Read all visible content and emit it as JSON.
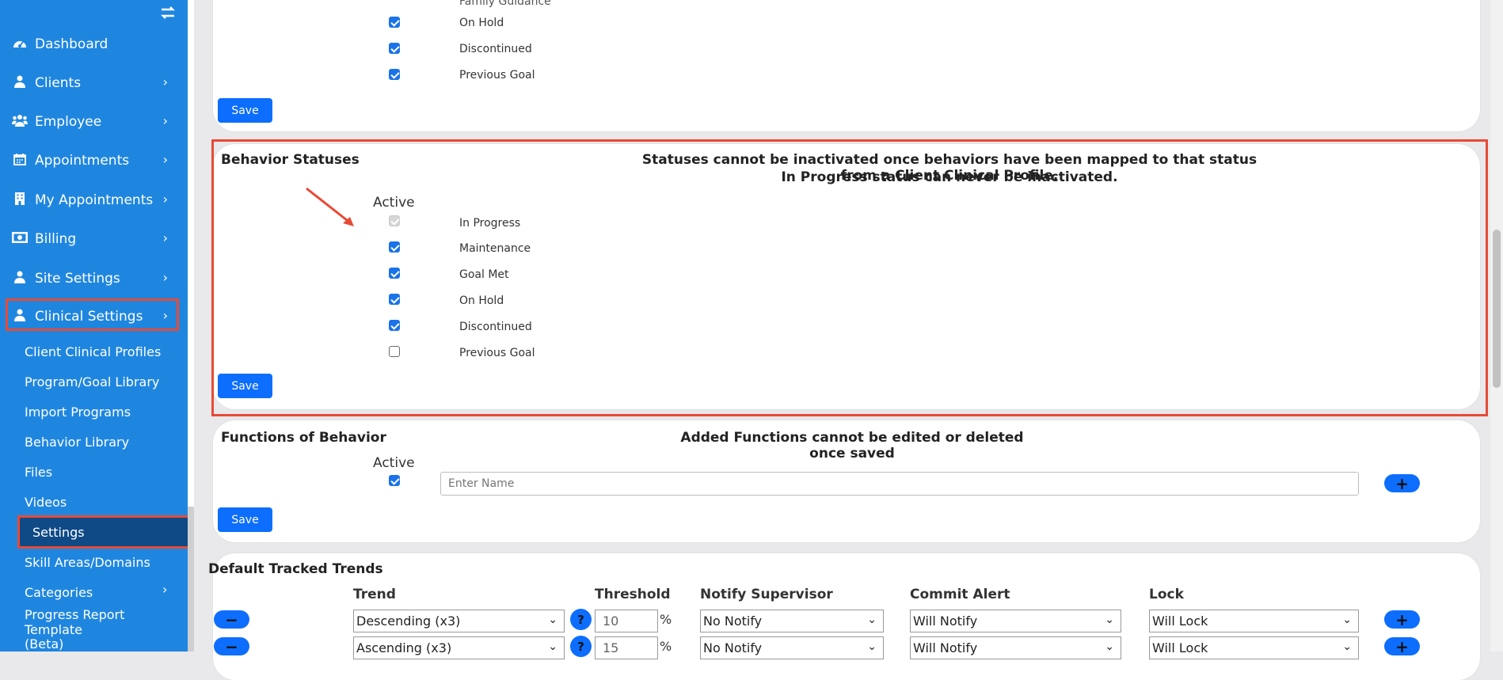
{
  "sidebar": {
    "toggle_icon": "swap-arrows-icon",
    "items": [
      {
        "label": "Dashboard",
        "icon": "dashboard-icon",
        "has_chevron": false
      },
      {
        "label": "Clients",
        "icon": "user-icon",
        "has_chevron": true
      },
      {
        "label": "Employee",
        "icon": "users-icon",
        "has_chevron": true
      },
      {
        "label": "Appointments",
        "icon": "calendar-icon",
        "has_chevron": true
      },
      {
        "label": "My Appointments",
        "icon": "building-icon",
        "has_chevron": true
      },
      {
        "label": "Billing",
        "icon": "money-icon",
        "has_chevron": true
      },
      {
        "label": "Site Settings",
        "icon": "user-icon",
        "has_chevron": true
      },
      {
        "label": "Clinical Settings",
        "icon": "user-icon",
        "has_chevron": true
      }
    ],
    "sub_items": [
      {
        "label": "Client Clinical Profiles"
      },
      {
        "label": "Program/Goal Library"
      },
      {
        "label": "Import Programs"
      },
      {
        "label": "Behavior Library"
      },
      {
        "label": "Files"
      },
      {
        "label": "Videos"
      },
      {
        "label": "Settings",
        "active": true
      },
      {
        "label": "Skill Areas/Domains"
      },
      {
        "label": "Categories",
        "has_chevron": true
      },
      {
        "label": "Progress Report Template"
      },
      {
        "label": "(Beta)"
      }
    ]
  },
  "top_card": {
    "partial_label": "Family Guidance",
    "rows": [
      {
        "label": "On Hold",
        "checked": true
      },
      {
        "label": "Discontinued",
        "checked": true
      },
      {
        "label": "Previous Goal",
        "checked": true
      }
    ],
    "save_label": "Save"
  },
  "behavior_statuses": {
    "title": "Behavior Statuses",
    "note_line1": "Statuses cannot be inactivated once behaviors have been mapped to that status from a Client Clinical Profile.",
    "note_line2": "In Progress status can never be inactivated.",
    "active_header": "Active",
    "rows": [
      {
        "label": "In Progress",
        "state": "disabled"
      },
      {
        "label": "Maintenance",
        "state": "checked"
      },
      {
        "label": "Goal Met",
        "state": "checked"
      },
      {
        "label": "On Hold",
        "state": "checked"
      },
      {
        "label": "Discontinued",
        "state": "checked"
      },
      {
        "label": "Previous Goal",
        "state": "unchecked"
      }
    ],
    "save_label": "Save"
  },
  "functions_of_behavior": {
    "title": "Functions of Behavior",
    "note": "Added Functions cannot be edited or deleted once saved",
    "active_header": "Active",
    "name_placeholder": "Enter Name",
    "add_symbol": "+",
    "save_label": "Save"
  },
  "default_tracked_trends": {
    "title": "Default Tracked Trends",
    "headers": {
      "trend": "Trend",
      "threshold": "Threshold",
      "notify_supervisor": "Notify Supervisor",
      "commit_alert": "Commit Alert",
      "lock": "Lock"
    },
    "pct_symbol": "%",
    "remove_symbol": "−",
    "add_symbol": "+",
    "help_symbol": "?",
    "rows": [
      {
        "trend": "Descending (x3)",
        "threshold": "10",
        "notify": "No Notify",
        "commit": "Will Notify",
        "lock": "Will Lock"
      },
      {
        "trend": "Ascending (x3)",
        "threshold": "15",
        "notify": "No Notify",
        "commit": "Will Notify",
        "lock": "Will Lock"
      }
    ]
  },
  "colors": {
    "sidebar_bg": "#1f86e0",
    "accent": "#0d6efd",
    "highlight": "#e84a35",
    "active_item_bg": "#0f4a86"
  }
}
